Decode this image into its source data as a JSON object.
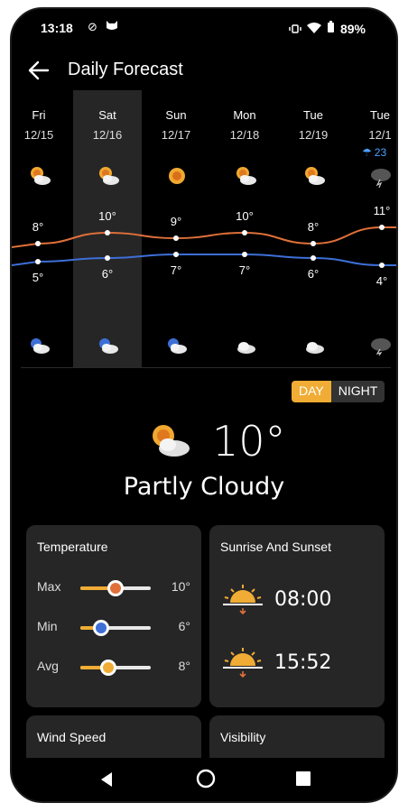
{
  "status_bar": {
    "time": "13:18",
    "battery": "89%",
    "icons": [
      "no-disturb-icon",
      "cat-icon",
      "vibrate-icon",
      "wifi-icon",
      "battery-icon"
    ]
  },
  "header": {
    "title": "Daily Forecast"
  },
  "forecast": {
    "days": [
      {
        "name": "Fri",
        "date": "12/15",
        "high": "8°",
        "low": "5°",
        "day_icon": "partly-cloudy-icon",
        "night_icon": "cloudy-night-icon"
      },
      {
        "name": "Sat",
        "date": "12/16",
        "high": "10°",
        "low": "6°",
        "day_icon": "partly-cloudy-icon",
        "night_icon": "cloudy-night-icon",
        "selected": true
      },
      {
        "name": "Sun",
        "date": "12/17",
        "high": "9°",
        "low": "7°",
        "day_icon": "sunny-icon",
        "night_icon": "cloudy-night-icon"
      },
      {
        "name": "Mon",
        "date": "12/18",
        "high": "10°",
        "low": "7°",
        "day_icon": "partly-cloudy-icon",
        "night_icon": "cloudy-icon"
      },
      {
        "name": "Tue",
        "date": "12/19",
        "high": "8°",
        "low": "6°",
        "day_icon": "partly-cloudy-icon",
        "night_icon": "cloudy-icon"
      },
      {
        "name": "Tue",
        "date": "12/1",
        "high": "11°",
        "low": "4°",
        "day_icon": "storm-icon",
        "night_icon": "storm-icon"
      }
    ],
    "rain": "23",
    "high_color": "#e0703a",
    "low_color": "#3d6fd6"
  },
  "toggle": {
    "day": "DAY",
    "night": "NIGHT",
    "active_color": "#f0ac34"
  },
  "current": {
    "temp": "10°",
    "condition": "Partly Cloudy"
  },
  "temperature_card": {
    "title": "Temperature",
    "rows": [
      {
        "label": "Max",
        "value": "10°",
        "level": 0.5,
        "color": "#e0703a"
      },
      {
        "label": "Min",
        "value": "6°",
        "level": 0.3,
        "color": "#3d6fd6"
      },
      {
        "label": "Avg",
        "value": "8°",
        "level": 0.4,
        "color": "#f0ac34"
      }
    ]
  },
  "sun_card": {
    "title": "Sunrise And Sunset",
    "sunrise": "08:00",
    "sunset": "15:52"
  },
  "wind_card": {
    "title": "Wind Speed"
  },
  "visibility_card": {
    "title": "Visibility"
  }
}
